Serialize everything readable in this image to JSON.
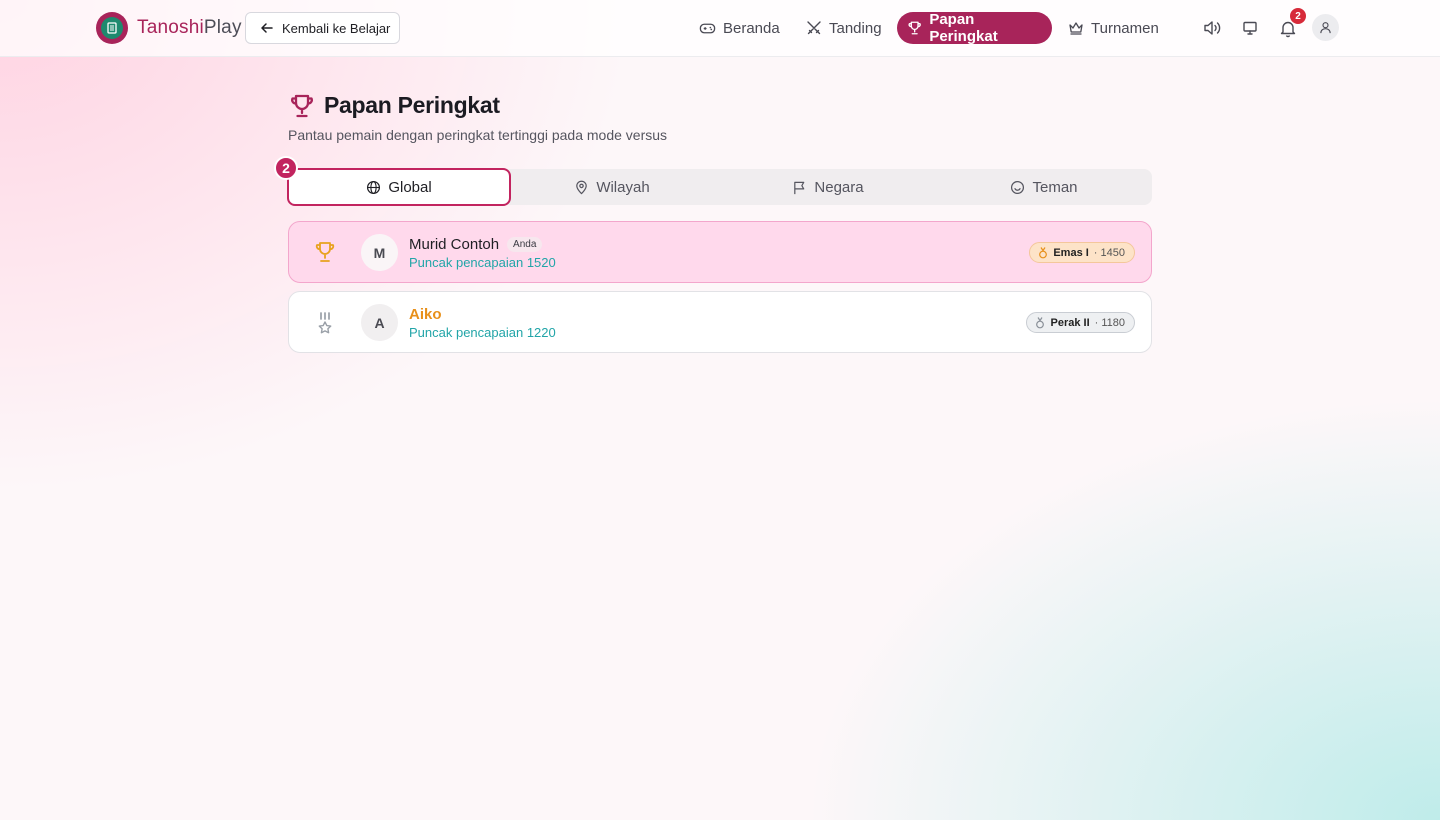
{
  "app": {
    "brand_first": "Tanoshi",
    "brand_second": "Play"
  },
  "header": {
    "back_label": "Kembali ke Belajar",
    "nav": [
      {
        "label": "Beranda",
        "icon": "gamepad-icon"
      },
      {
        "label": "Tanding",
        "icon": "swords-icon"
      },
      {
        "label": "Papan Peringkat",
        "icon": "trophy-icon",
        "active": true
      },
      {
        "label": "Turnamen",
        "icon": "crown-icon"
      }
    ],
    "notification_count": "2"
  },
  "page": {
    "title": "Papan Peringkat",
    "subtitle": "Pantau pemain dengan peringkat tertinggi pada mode versus",
    "step_marker": "2"
  },
  "tabs": [
    {
      "label": "Global",
      "icon": "globe-icon",
      "active": true
    },
    {
      "label": "Wilayah",
      "icon": "map-pin-icon"
    },
    {
      "label": "Negara",
      "icon": "flag-icon"
    },
    {
      "label": "Teman",
      "icon": "smile-icon"
    }
  ],
  "leaderboard": [
    {
      "initial": "M",
      "name": "Murid Contoh",
      "you_tag": "Anda",
      "peak": "Puncak pencapaian 1520",
      "tier": "Emas I",
      "points": "· 1450",
      "rank_icon": "trophy-icon",
      "is_me": true
    },
    {
      "initial": "A",
      "name": "Aiko",
      "peak": "Puncak pencapaian 1220",
      "tier": "Perak II",
      "points": "· 1180",
      "rank_icon": "medal-icon",
      "is_me": false
    }
  ],
  "colors": {
    "brand": "#a8245a",
    "accent": "#c2245f",
    "teal": "#22a5a8",
    "gold": "#e8901a"
  }
}
